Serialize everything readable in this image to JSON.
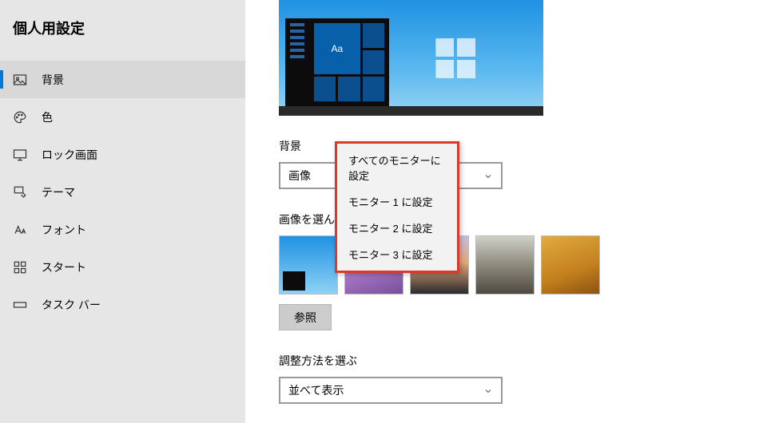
{
  "sidebar": {
    "title": "個人用設定",
    "items": [
      {
        "label": "背景"
      },
      {
        "label": "色"
      },
      {
        "label": "ロック画面"
      },
      {
        "label": "テーマ"
      },
      {
        "label": "フォント"
      },
      {
        "label": "スタート"
      },
      {
        "label": "タスク バー"
      }
    ]
  },
  "preview": {
    "tile_text": "Aa"
  },
  "background": {
    "label": "背景",
    "combo_value": "画像",
    "pick_label": "画像を選んでください",
    "browse_label": "参照"
  },
  "fit": {
    "label": "調整方法を選ぶ",
    "combo_value": "並べて表示"
  },
  "context_menu": {
    "items": [
      {
        "label": "すべてのモニターに設定"
      },
      {
        "label": "モニター 1 に設定"
      },
      {
        "label": "モニター 2 に設定"
      },
      {
        "label": "モニター 3 に設定"
      }
    ]
  }
}
